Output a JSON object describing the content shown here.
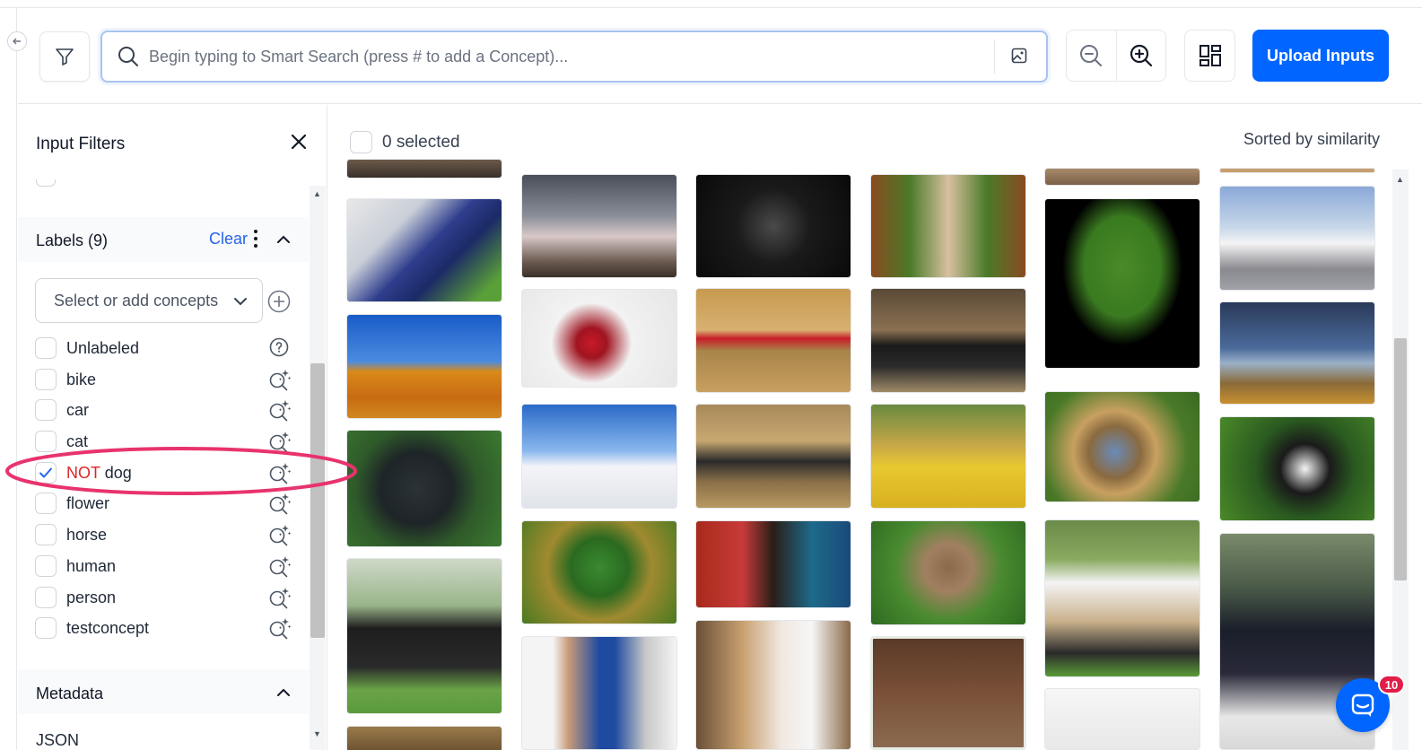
{
  "toolbar": {
    "search_placeholder": "Begin typing to Smart Search (press # to add a Concept)...",
    "upload_label": "Upload Inputs"
  },
  "sidebar": {
    "title": "Input Filters",
    "labels": {
      "title": "Labels (9)",
      "clear": "Clear",
      "select_placeholder": "Select or add concepts",
      "items": [
        {
          "label": "Unlabeled",
          "checked": false,
          "icon": "help-circle-icon"
        },
        {
          "label": "bike",
          "checked": false,
          "icon": "magic-search-icon"
        },
        {
          "label": "car",
          "checked": false,
          "icon": "magic-search-icon"
        },
        {
          "label": "cat",
          "checked": false,
          "icon": "magic-search-icon"
        },
        {
          "label": "NOT",
          "label_rest": "dog",
          "checked": true,
          "icon": "magic-search-icon"
        },
        {
          "label": "flower",
          "checked": false,
          "icon": "magic-search-icon"
        },
        {
          "label": "horse",
          "checked": false,
          "icon": "magic-search-icon"
        },
        {
          "label": "human",
          "checked": false,
          "icon": "magic-search-icon"
        },
        {
          "label": "person",
          "checked": false,
          "icon": "magic-search-icon"
        },
        {
          "label": "testconcept",
          "checked": false,
          "icon": "magic-search-icon"
        }
      ]
    },
    "metadata": {
      "title": "Metadata",
      "json_label": "JSON"
    }
  },
  "main": {
    "selected_count": "0 selected",
    "sort_label": "Sorted by similarity"
  },
  "chat": {
    "badge": "10"
  },
  "colors": {
    "accent": "#0066ff",
    "negative": "#dc2626",
    "annotation": "#e8336d"
  }
}
